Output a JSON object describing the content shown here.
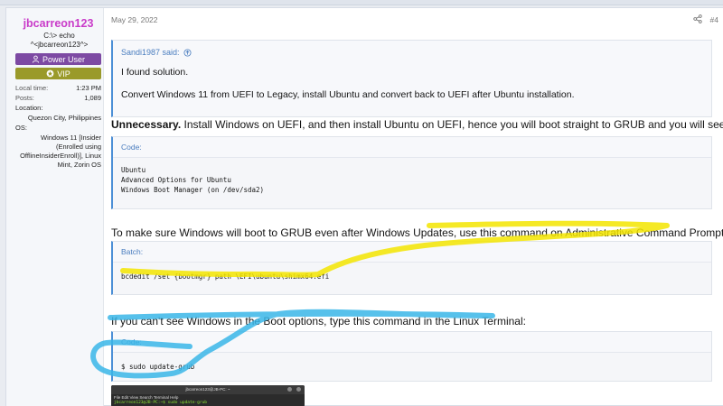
{
  "user": {
    "name": "jbcarreon123",
    "title_line1": "C:\\> echo",
    "title_line2": "^<jbcarreon123^>",
    "banners": {
      "power": "Power User",
      "vip": "VIP"
    },
    "local_time_label": "Local time:",
    "local_time": "1:23 PM",
    "posts_label": "Posts:",
    "posts": "1,089",
    "location_label": "Location:",
    "location": "Quezon City, Philippines",
    "os_label": "OS:",
    "os": "Windows 11 [Insider (Enrolled using OfflineInsiderEnroll)], Linux Mint, Zorin OS"
  },
  "post": {
    "date": "May 29, 2022",
    "number": "#4",
    "quote": {
      "author": "Sandi1987 said:",
      "line1": "I found solution.",
      "line2": "Convert Windows 11 from UEFI to Legacy, install Ubuntu and convert back to UEFI after Ubuntu installation."
    },
    "para1_bold": "Unnecessary.",
    "para1_rest": " Install Windows on UEFI, and then install Ubuntu on UEFI, hence you will boot straight to GRUB and you will see:",
    "code1": {
      "label": "Code:",
      "body": "Ubuntu\nAdvanced Options for Ubuntu\nWindows Boot Manager (on /dev/sda2)"
    },
    "para2": "To make sure Windows will boot to GRUB even after Windows Updates, use this command on Administrative Command Prompt:",
    "code2": {
      "label": "Batch:",
      "body": "bcdedit /set {bootmgr} path \\EFI\\ubuntu\\shimx64.efi"
    },
    "para3": "If you can't see Windows in the Boot options, type this command in the Linux Terminal:",
    "code3": {
      "label": "Code:",
      "body": "$ sudo update-grub"
    },
    "terminal": {
      "title": "jbcarreon123@JB-PC: ~",
      "menu": "File  Edit  View  Search  Terminal  Help",
      "line": "jbcarreon123@JB-PC:~$ sudo update-grub"
    }
  },
  "colors": {
    "username": "#c93bc9",
    "power_banner": "#7d4aa3",
    "vip_banner": "#9a9a2a",
    "quote_accent": "#4c8fd6",
    "highlight_yellow": "#f3e500",
    "highlight_blue": "#3ab6e8"
  },
  "icons": {
    "power": "user-icon",
    "vip": "star-badge-icon",
    "quote": "arrow-up-circle-icon",
    "share": "share-icon"
  }
}
